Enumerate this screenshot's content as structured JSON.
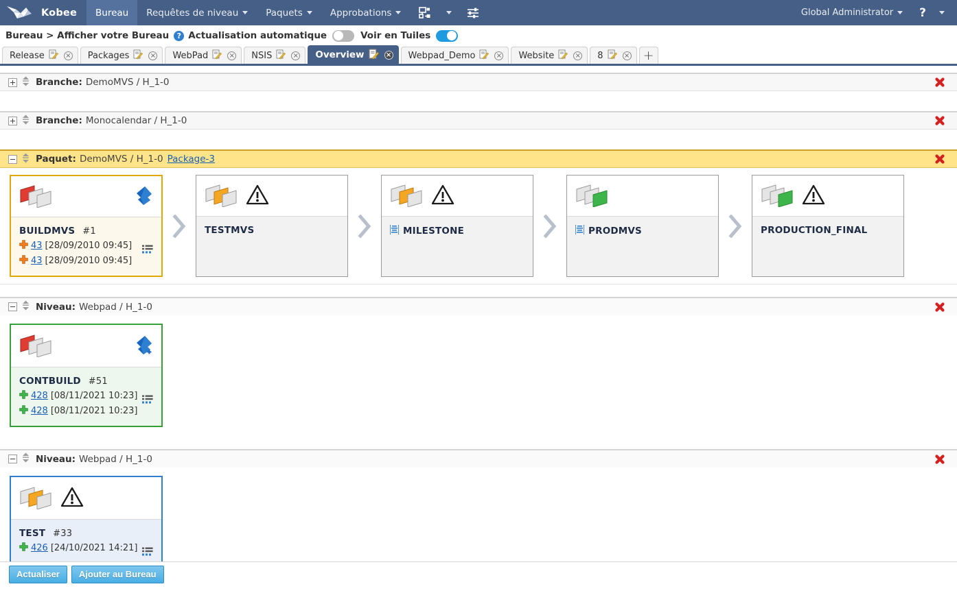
{
  "topnav": {
    "logo_icon": "hummingbird-logo-icon",
    "brand": "Kobee",
    "items": [
      {
        "label": "Bureau",
        "active": true,
        "caret": false
      },
      {
        "label": "Requêtes de niveau",
        "active": false,
        "caret": true
      },
      {
        "label": "Paquets",
        "active": false,
        "caret": true
      },
      {
        "label": "Approbations",
        "active": false,
        "caret": true
      }
    ],
    "icons": [
      {
        "name": "sitemap-icon"
      },
      {
        "name": "chevron-down-icon"
      },
      {
        "name": "sliders-icon"
      }
    ],
    "user": "Global Administrator",
    "help_label": "?",
    "help_caret": true
  },
  "breadcrumb": {
    "path": "Bureau > Afficher votre Bureau",
    "help_icon_label": "?",
    "autorefresh_label": "Actualisation automatique",
    "autorefresh_on": false,
    "tiles_label": "Voir en Tuiles",
    "tiles_on": true
  },
  "tabs": {
    "items": [
      {
        "label": "Release",
        "active": false
      },
      {
        "label": "Packages",
        "active": false
      },
      {
        "label": "WebPad",
        "active": false
      },
      {
        "label": "NSIS",
        "active": false
      },
      {
        "label": "Overview",
        "active": true
      },
      {
        "label": "Webpad_Demo",
        "active": false
      },
      {
        "label": "Website",
        "active": false
      },
      {
        "label": "8",
        "active": false
      }
    ],
    "add_label": "+",
    "close_label": "×",
    "edit_icon": "pencil-note-icon"
  },
  "sections": [
    {
      "kind": "branch",
      "expanded": false,
      "title": "Branche:",
      "subtitle": "DemoMVS / H_1-0",
      "link": "",
      "tiles": []
    },
    {
      "kind": "branch",
      "expanded": false,
      "title": "Branche:",
      "subtitle": "Monocalendar / H_1-0",
      "link": "",
      "tiles": []
    },
    {
      "kind": "package",
      "expanded": true,
      "title": "Paquet:",
      "subtitle": "DemoMVS / H_1-0",
      "link": "Package-3",
      "tiles": [
        {
          "name": "BUILDMVS",
          "number": "#1",
          "state": "selected-yellow",
          "stack_icon": "stack-red-icon",
          "corner_icon": "blue-arrow-up-icon",
          "warning": false,
          "milestone_icon": false,
          "detail_icon": "detail-list-icon",
          "lines": [
            {
              "plus": "orange",
              "link": "43",
              "text": "[28/09/2010 09:45]"
            },
            {
              "plus": "orange",
              "link": "43",
              "text": "[28/09/2010 09:45]"
            }
          ]
        },
        {
          "name": "TESTMVS",
          "number": "",
          "state": "plain",
          "stack_icon": "stack-orange-icon",
          "corner_icon": "",
          "warning": true,
          "milestone_icon": false,
          "detail_icon": "",
          "lines": []
        },
        {
          "name": "MILESTONE",
          "number": "",
          "state": "plain",
          "stack_icon": "stack-orange-icon",
          "corner_icon": "",
          "warning": true,
          "milestone_icon": true,
          "detail_icon": "",
          "lines": []
        },
        {
          "name": "PRODMVS",
          "number": "",
          "state": "plain",
          "stack_icon": "stack-green-icon",
          "corner_icon": "",
          "warning": false,
          "milestone_icon": true,
          "detail_icon": "",
          "lines": []
        },
        {
          "name": "PRODUCTION_FINAL",
          "number": "",
          "state": "plain",
          "stack_icon": "stack-green-icon",
          "corner_icon": "",
          "warning": true,
          "milestone_icon": false,
          "detail_icon": "",
          "lines": []
        }
      ]
    },
    {
      "kind": "level",
      "expanded": true,
      "title": "Niveau:",
      "subtitle": "Webpad / H_1-0",
      "link": "",
      "tiles": [
        {
          "name": "CONTBUILD",
          "number": "#51",
          "state": "selected-green",
          "stack_icon": "stack-red-icon",
          "corner_icon": "blue-arrow-up-plus-icon",
          "warning": false,
          "milestone_icon": false,
          "detail_icon": "detail-list-icon",
          "lines": [
            {
              "plus": "green",
              "link": "428",
              "text": "[08/11/2021 10:23]"
            },
            {
              "plus": "green",
              "link": "428",
              "text": "[08/11/2021 10:23]"
            }
          ]
        }
      ]
    },
    {
      "kind": "level",
      "expanded": true,
      "title": "Niveau:",
      "subtitle": "Webpad / H_1-0",
      "link": "",
      "tiles": [
        {
          "name": "TEST",
          "number": "#33",
          "state": "selected-blue",
          "stack_icon": "stack-orange-icon",
          "corner_icon": "",
          "warning": true,
          "milestone_icon": false,
          "detail_icon": "detail-list-icon",
          "lines": [
            {
              "plus": "green",
              "link": "426",
              "text": "[24/10/2021 14:21]"
            }
          ]
        }
      ]
    }
  ],
  "footer": {
    "refresh_label": "Actualiser",
    "add_label": "Ajouter au Bureau"
  },
  "colors": {
    "nav_bg": "#465f86",
    "nav_active": "#55729f",
    "package_header": "#ffe48a",
    "accent_link": "#1a5fb4",
    "toggle_on": "#1e9ae0",
    "delete_red": "#d42020",
    "button_blue": "#49aee4"
  }
}
